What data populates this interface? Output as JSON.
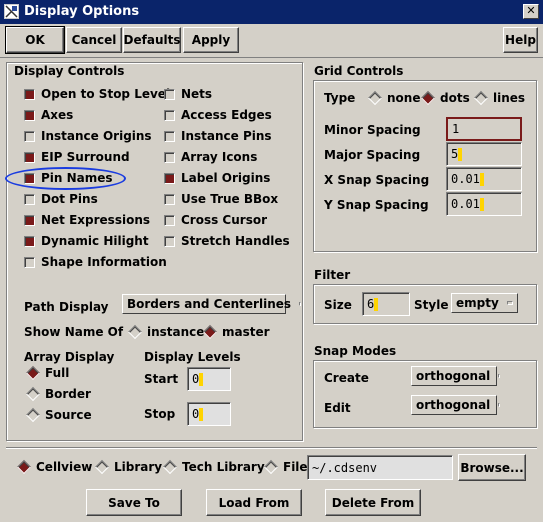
{
  "window": {
    "title": "Display Options",
    "close": "✕"
  },
  "toolbar": {
    "ok": "OK",
    "cancel": "Cancel",
    "defaults": "Defaults",
    "apply": "Apply",
    "help": "Help"
  },
  "display_controls": {
    "title": "Display Controls",
    "items": [
      {
        "label": "Open to Stop Level",
        "checked": true
      },
      {
        "label": "Nets",
        "checked": false
      },
      {
        "label": "Axes",
        "checked": true
      },
      {
        "label": "Access Edges",
        "checked": false
      },
      {
        "label": "Instance Origins",
        "checked": false
      },
      {
        "label": "Instance Pins",
        "checked": false
      },
      {
        "label": "EIP Surround",
        "checked": true
      },
      {
        "label": "Array Icons",
        "checked": false
      },
      {
        "label": "Pin Names",
        "checked": true
      },
      {
        "label": "Label Origins",
        "checked": true
      },
      {
        "label": "Dot Pins",
        "checked": false
      },
      {
        "label": "Use True BBox",
        "checked": false
      },
      {
        "label": "Net Expressions",
        "checked": true
      },
      {
        "label": "Cross Cursor",
        "checked": false
      },
      {
        "label": "Dynamic Hilight",
        "checked": true
      },
      {
        "label": "Stretch Handles",
        "checked": false
      },
      {
        "label": "Shape Information",
        "checked": false
      }
    ],
    "path_display_label": "Path Display",
    "path_display_value": "Borders and Centerlines",
    "show_name_of_label": "Show Name Of",
    "show_name_options": [
      "instance",
      "master"
    ],
    "show_name_selected": "master",
    "array_display_label": "Array Display",
    "array_display_options": [
      "Full",
      "Border",
      "Source"
    ],
    "array_display_selected": "Full",
    "display_levels_label": "Display Levels",
    "start_label": "Start",
    "start_value": "0",
    "stop_label": "Stop",
    "stop_value": "0"
  },
  "grid_controls": {
    "title": "Grid Controls",
    "type_label": "Type",
    "type_options": [
      "none",
      "dots",
      "lines"
    ],
    "type_selected": "dots",
    "minor_label": "Minor Spacing",
    "minor_value": "1",
    "major_label": "Major Spacing",
    "major_value": "5",
    "xsnap_label": "X Snap Spacing",
    "xsnap_value": "0.01",
    "ysnap_label": "Y Snap Spacing",
    "ysnap_value": "0.01"
  },
  "filter": {
    "title": "Filter",
    "size_label": "Size",
    "size_value": "6",
    "style_label": "Style",
    "style_value": "empty"
  },
  "snap_modes": {
    "title": "Snap Modes",
    "create_label": "Create",
    "create_value": "orthogonal",
    "edit_label": "Edit",
    "edit_value": "orthogonal"
  },
  "footer": {
    "scope_options": [
      "Cellview",
      "Library",
      "Tech Library",
      "File"
    ],
    "scope_selected": "Cellview",
    "file_path": "~/.cdsenv",
    "browse": "Browse...",
    "save_to": "Save To",
    "load_from": "Load From",
    "delete_from": "Delete From"
  },
  "colors": {
    "checked": "#7a1a1a",
    "annotation_ellipse": "#1a3ce0",
    "title_bar": "#0a246a"
  },
  "icons": {
    "app": "layout-icon",
    "close": "close-icon"
  }
}
